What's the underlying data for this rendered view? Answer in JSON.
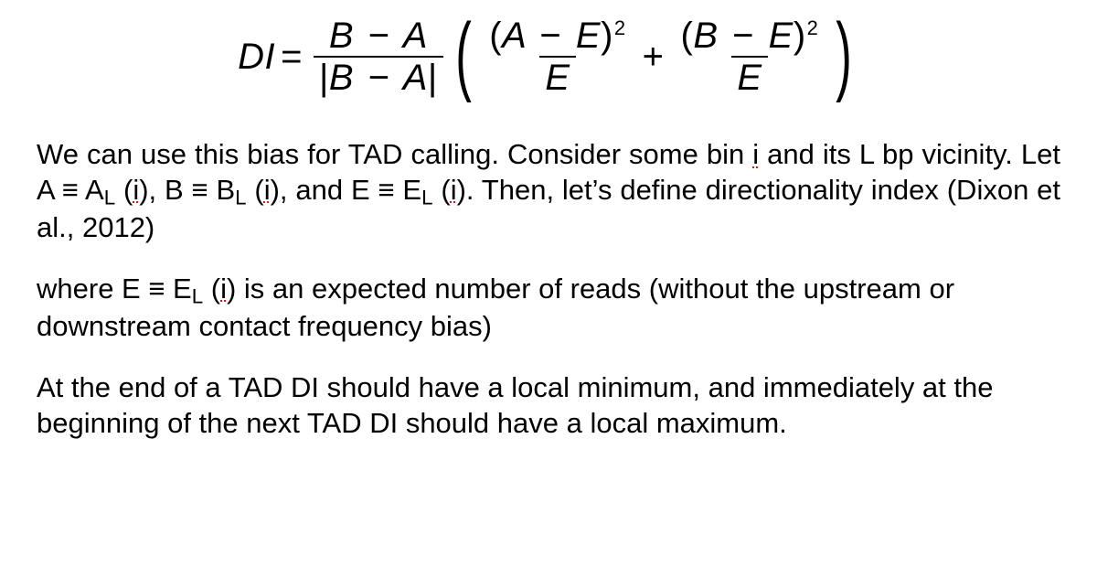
{
  "formula": {
    "lhs": "DI",
    "frac1": {
      "num_left": "B",
      "num_right": "A",
      "den_left_bar": "|",
      "den_mid_left": "B",
      "den_mid_right": "A",
      "den_right_bar": "|"
    },
    "term1": {
      "num_open": "(",
      "num_a": "A",
      "num_b": "E",
      "num_close": ")",
      "num_exp": "2",
      "den": "E"
    },
    "term2": {
      "num_open": "(",
      "num_a": "B",
      "num_b": "E",
      "num_close": ")",
      "num_exp": "2",
      "den": "E"
    }
  },
  "para1": {
    "t1": "We can use this bias for TAD calling. Consider some bin ",
    "i1": "i",
    "t2": " and its L bp vicinity. Let A ≡ A",
    "sub1": "L",
    "t3": " (",
    "i2": "i",
    "t4": "), B ≡ B",
    "sub2": "L",
    "t5": " (",
    "i3": "i",
    "t6": "), and E ≡ E",
    "sub3": "L",
    "t7": " (",
    "i4": "i",
    "t8": "). Then, let’s define directionality index (Dixon et al., 2012)"
  },
  "para2": {
    "t1": "where E ≡ E",
    "sub1": "L",
    "t2": " (",
    "i1": "i",
    "t3": ") is an expected number of reads (without the upstream or downstream contact frequency bias)"
  },
  "para3": {
    "t1": "At the end of a TAD DI should have a local minimum, and immediately at the beginning of the next TAD DI should have a local maximum."
  }
}
